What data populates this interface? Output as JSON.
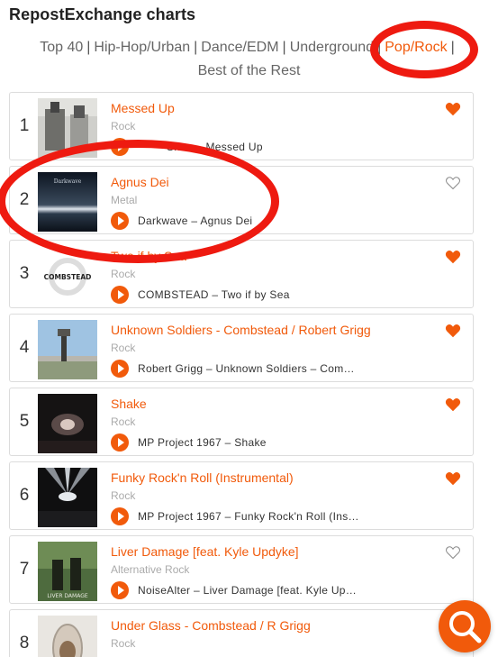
{
  "page": {
    "title": "RepostExchange charts"
  },
  "tabs": [
    {
      "label": "Top 40",
      "active": false
    },
    {
      "label": "Hip-Hop/Urban",
      "active": false
    },
    {
      "label": "Dance/EDM",
      "active": false
    },
    {
      "label": "Underground",
      "active": false
    },
    {
      "label": "Pop/Rock",
      "active": true
    },
    {
      "label": "Best of the Rest",
      "active": false
    }
  ],
  "tracks": [
    {
      "rank": "1",
      "title": "Messed Up",
      "genre": "Rock",
      "track_line": "Shea – Messed Up",
      "favorited": true
    },
    {
      "rank": "2",
      "title": "Agnus Dei",
      "genre": "Metal",
      "track_line": "Darkwave – Agnus Dei",
      "favorited": false
    },
    {
      "rank": "3",
      "title": "Two if by Sea",
      "genre": "Rock",
      "track_line": "COMBSTEAD – Two if by Sea",
      "favorited": true
    },
    {
      "rank": "4",
      "title": "Unknown Soldiers - Combstead / Robert Grigg",
      "genre": "Rock",
      "track_line": "Robert Grigg – Unknown Soldiers – Com…",
      "favorited": true
    },
    {
      "rank": "5",
      "title": "Shake",
      "genre": "Rock",
      "track_line": "MP Project 1967 – Shake",
      "favorited": true
    },
    {
      "rank": "6",
      "title": "Funky Rock'n Roll (Instrumental)",
      "genre": "Rock",
      "track_line": "MP Project 1967 – Funky Rock'n Roll (Ins…",
      "favorited": true
    },
    {
      "rank": "7",
      "title": "Liver Damage [feat. Kyle Updyke]",
      "genre": "Alternative Rock",
      "track_line": "NoiseAlter – Liver Damage [feat. Kyle Up…",
      "favorited": false
    },
    {
      "rank": "8",
      "title": "Under Glass - Combstead / R Grigg",
      "genre": "Rock",
      "track_line": "",
      "favorited": false
    }
  ],
  "artwork_text": {
    "art2": "Darkwave",
    "art3": "COMBSTEAD",
    "art7": "LIVER DAMAGE"
  },
  "colors": {
    "accent": "#f15a0b",
    "annotation": "#ee1a10",
    "genre_text": "#aaaaaa"
  },
  "icons": {
    "favorite": "heart-icon",
    "play": "play-icon",
    "search": "search-icon"
  }
}
